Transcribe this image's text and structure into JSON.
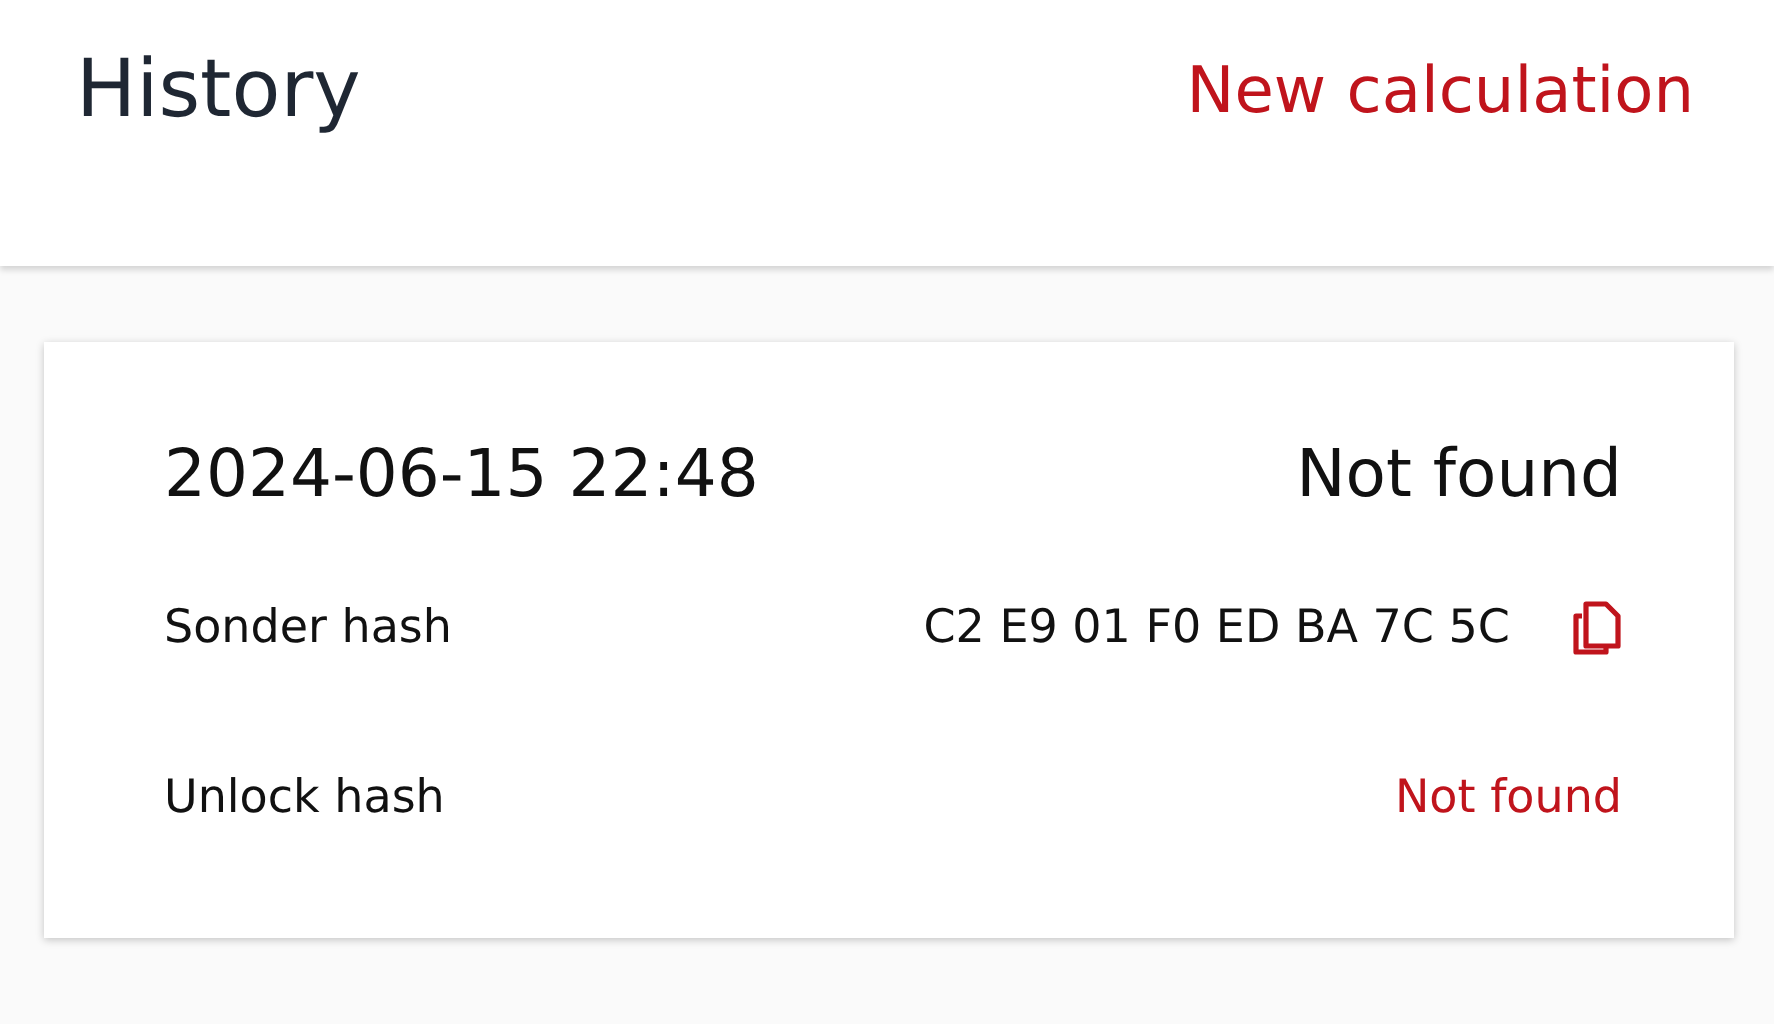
{
  "header": {
    "title": "History",
    "action": "New calculation"
  },
  "entries": [
    {
      "timestamp": "2024-06-15 22:48",
      "status": "Not found",
      "rows": [
        {
          "kind": "hash",
          "label": "Sonder hash",
          "value": "C2 E9 01 F0 ED BA 7C 5C"
        },
        {
          "kind": "not_found",
          "label": "Unlock hash",
          "value": "Not found"
        }
      ]
    }
  ]
}
